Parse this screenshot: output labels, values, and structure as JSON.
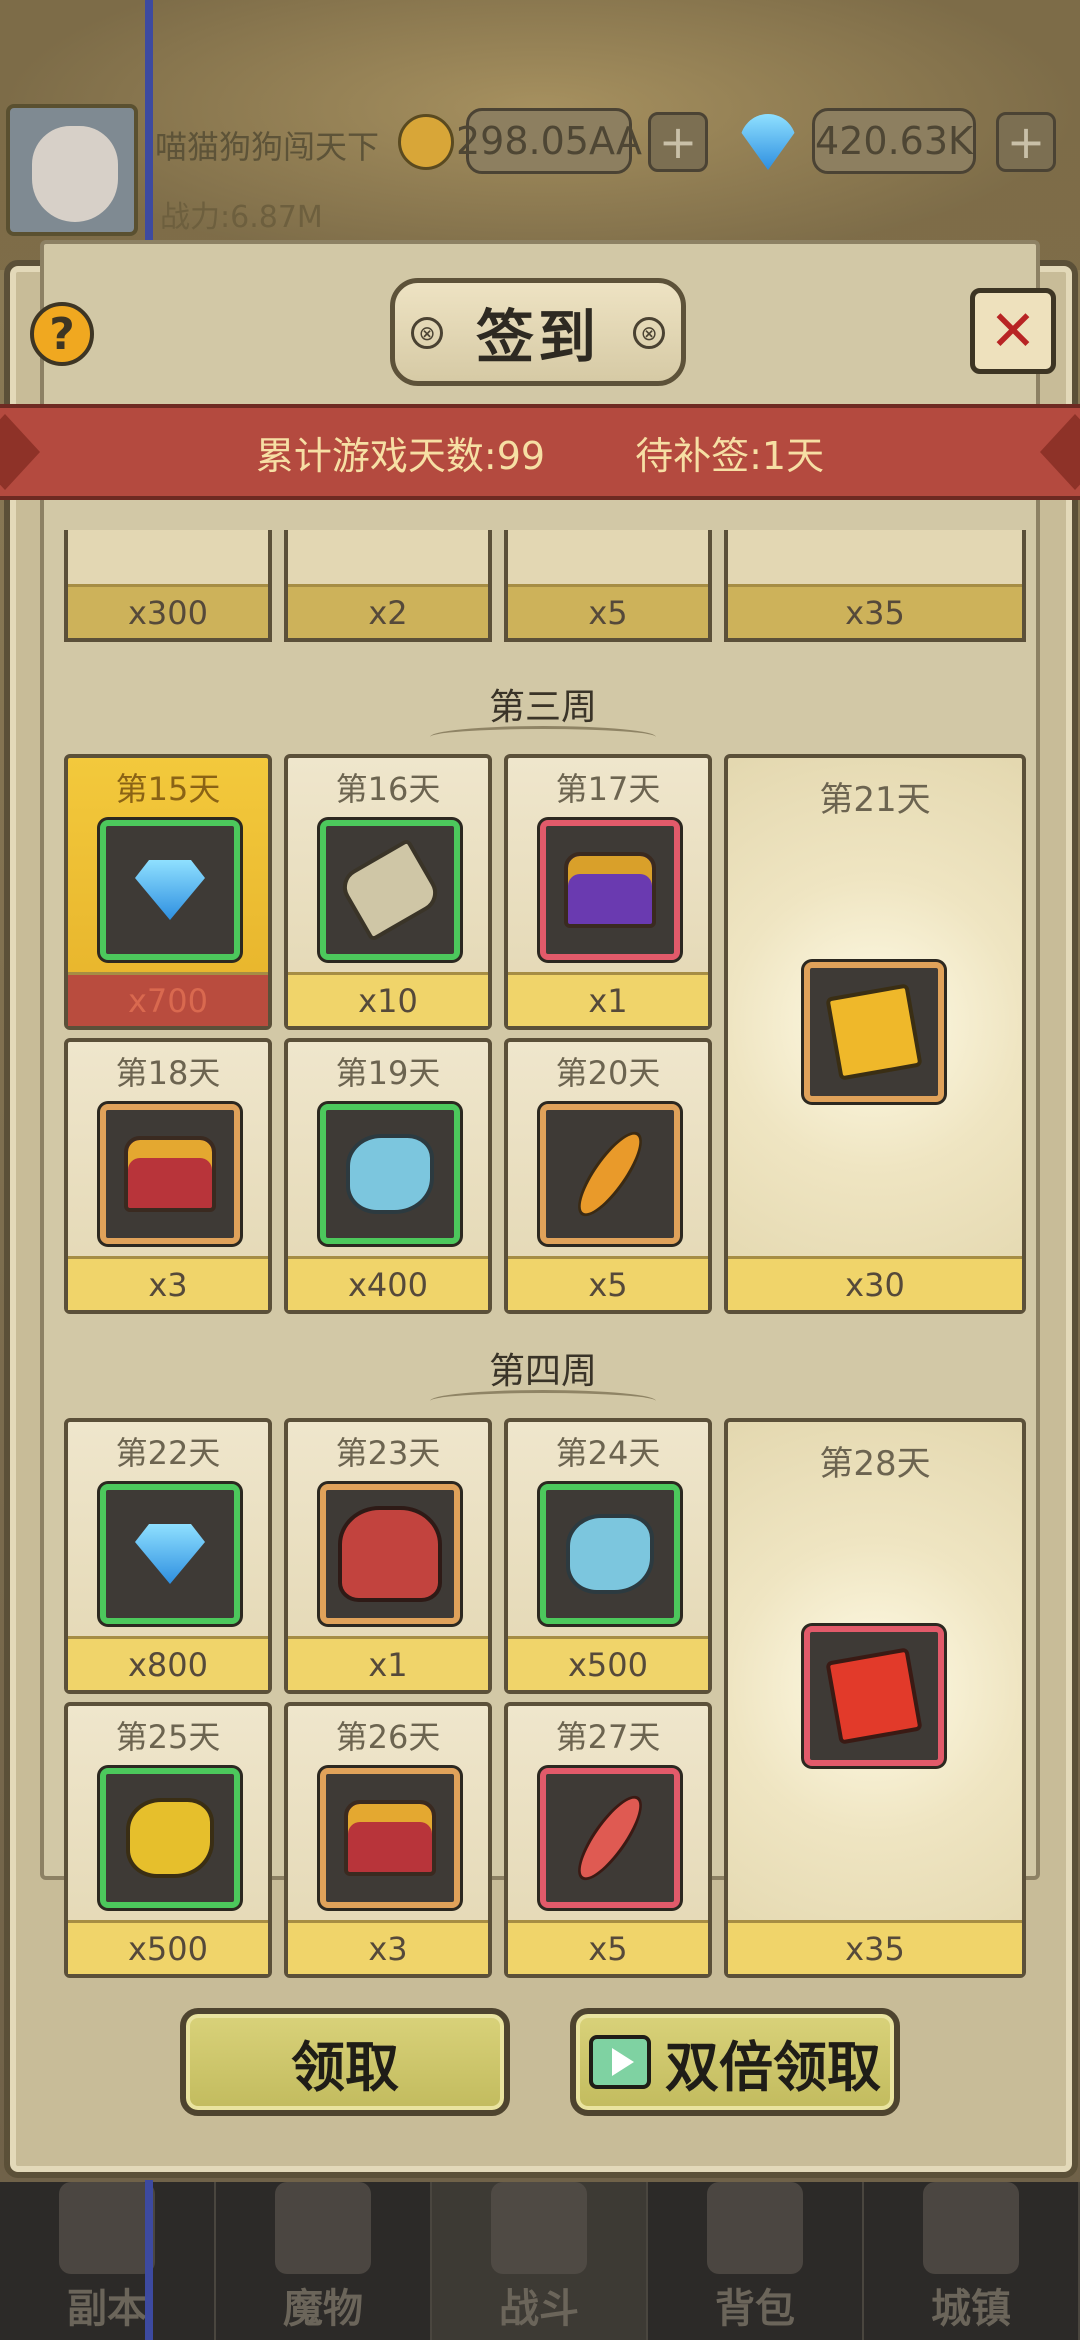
{
  "topbar": {
    "player_name": "喵猫狗狗闯天下",
    "power_label": "战力:6.87M",
    "gold": "298.05AA",
    "diamonds": "420.63K",
    "plus": "+"
  },
  "dialog": {
    "title": "签到",
    "help": "?",
    "close": "✕",
    "total_days": "累计游戏天数:99",
    "makeup": "待补签:1天"
  },
  "week2_tail": [
    "x300",
    "x2",
    "x5",
    "x35"
  ],
  "week3": {
    "title": "第三周",
    "days": [
      {
        "label": "第15天",
        "qty": "x700",
        "icon": "diamond-icon"
      },
      {
        "label": "第16天",
        "qty": "x10",
        "icon": "scroll-icon"
      },
      {
        "label": "第17天",
        "qty": "x1",
        "icon": "chest-icon"
      },
      {
        "label": "第18天",
        "qty": "x3",
        "icon": "chest-icon"
      },
      {
        "label": "第19天",
        "qty": "x400",
        "icon": "rune-stone-icon"
      },
      {
        "label": "第20天",
        "qty": "x5",
        "icon": "feather-icon"
      }
    ],
    "big": {
      "label": "第21天",
      "qty": "x30",
      "icon": "puzzle-piece-icon"
    }
  },
  "week4": {
    "title": "第四周",
    "days": [
      {
        "label": "第22天",
        "qty": "x800",
        "icon": "diamond-icon"
      },
      {
        "label": "第23天",
        "qty": "x1",
        "icon": "monster-icon"
      },
      {
        "label": "第24天",
        "qty": "x500",
        "icon": "rune-stone-icon"
      },
      {
        "label": "第25天",
        "qty": "x500",
        "icon": "gold-rune-icon"
      },
      {
        "label": "第26天",
        "qty": "x3",
        "icon": "chest-icon"
      },
      {
        "label": "第27天",
        "qty": "x5",
        "icon": "feather-icon"
      }
    ],
    "big": {
      "label": "第28天",
      "qty": "x35",
      "icon": "puzzle-piece-icon"
    }
  },
  "buttons": {
    "claim": "领取",
    "double_claim": "双倍领取"
  },
  "tabs": [
    "副本",
    "魔物",
    "战斗",
    "背包",
    "城镇"
  ]
}
